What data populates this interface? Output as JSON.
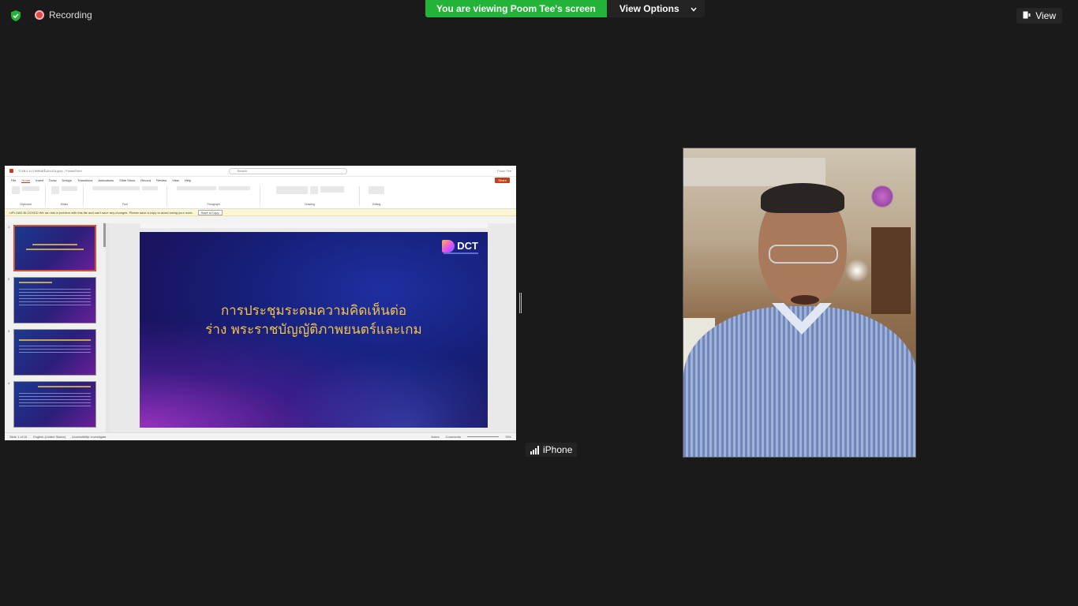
{
  "recording": {
    "label": "Recording"
  },
  "banner": {
    "text": "You are viewing Poom Tee's screen",
    "view_options": "View Options"
  },
  "view_button": {
    "label": "View"
  },
  "ppt": {
    "title": "ร่างพ.ร.บ.ภาพยนตร์และเกม.pptx - PowerPoint",
    "search_placeholder": "Search",
    "user": "Poom Tee",
    "menu": [
      "File",
      "Home",
      "Insert",
      "Draw",
      "Design",
      "Transitions",
      "Animations",
      "Slide Show",
      "Record",
      "Review",
      "View",
      "Help"
    ],
    "share_label": "Share",
    "ribbon_groups": [
      "Clipboard",
      "Slides",
      "Font",
      "Paragraph",
      "Drawing",
      "Editing"
    ],
    "infobar_text": "UPLOAD BLOCKED  We ran into a problem with this file and can't save any changes. Please save a copy to avoid losing your work.",
    "save_copy": "Save a Copy",
    "status": {
      "slide_of": "Slide 1 of 16",
      "language": "English (United States)",
      "accessibility": "Accessibility: Investigate",
      "notes": "Notes",
      "comments": "Comments",
      "zoom": "78%"
    },
    "slide": {
      "logo": "DCT",
      "title_line1": "การประชุมระดมความคิดเห็นต่อ",
      "title_line2": "ร่าง พระราชบัญญัติภาพยนตร์และเกม"
    },
    "thumb_numbers": [
      "1",
      "2",
      "3",
      "4"
    ]
  },
  "participant": {
    "name": "iPhone"
  },
  "colors": {
    "banner_green": "#23b339",
    "slide_title": "#f3c24a",
    "ppt_accent": "#c43e1c"
  },
  "icons": [
    "shield-check-icon",
    "record-dot-icon",
    "chevron-down-icon",
    "view-icon",
    "signal-bars-icon"
  ]
}
